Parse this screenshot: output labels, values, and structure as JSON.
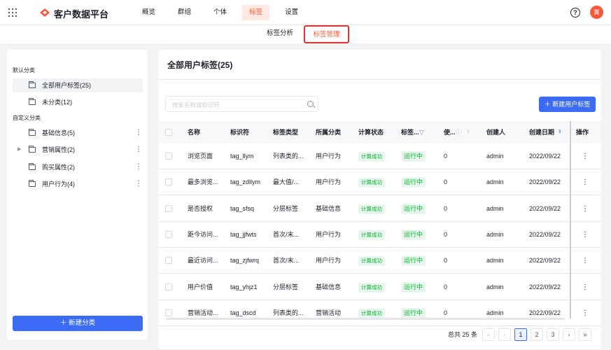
{
  "header": {
    "app_name": "客户数据平台",
    "nav": [
      "概览",
      "群组",
      "个体",
      "标签",
      "设置"
    ],
    "active_nav": "标签",
    "help_icon": "?",
    "avatar_text": "翼"
  },
  "subnav": {
    "tabs": [
      "标签分析",
      "标签管理"
    ],
    "active": "标签管理"
  },
  "sidebar": {
    "default_group": "默认分类",
    "default_items": [
      {
        "label": "全部用户标签(25)",
        "active": true
      },
      {
        "label": "未分类(12)",
        "active": false
      }
    ],
    "custom_group": "自定义分类",
    "custom_items": [
      {
        "label": "基础信息(5)",
        "expandable": false
      },
      {
        "label": "营销属性(2)",
        "expandable": true
      },
      {
        "label": "购买属性(2)",
        "expandable": false
      },
      {
        "label": "用户行为(4)",
        "expandable": false
      }
    ],
    "new_button": "新建分类"
  },
  "main": {
    "title": "全部用户标签(25)",
    "search_placeholder": "搜索名称或标识符",
    "new_button": "新建用户标签",
    "columns": [
      "名称",
      "标识符",
      "标签类型",
      "所属分类",
      "计算状态",
      "标签...",
      "使...",
      "创建人",
      "创建日期",
      "操作"
    ],
    "rows": [
      {
        "name": "浏览页面",
        "id": "tag_llym",
        "type": "列表类的...",
        "category": "用户行为",
        "calc": "计算成功",
        "status": "运行中",
        "uses": "0",
        "creator": "admin",
        "date": "2022/09/22"
      },
      {
        "name": "最多浏览...",
        "id": "tag_zdllym",
        "type": "最大值/...",
        "category": "用户行为",
        "calc": "计算成功",
        "status": "运行中",
        "uses": "0",
        "creator": "admin",
        "date": "2022/09/22"
      },
      {
        "name": "是否授权",
        "id": "tag_sfsq",
        "type": "分层标签",
        "category": "基础信息",
        "calc": "计算成功",
        "status": "运行中",
        "uses": "0",
        "creator": "admin",
        "date": "2022/09/22"
      },
      {
        "name": "距今访问...",
        "id": "tag_jjfwts",
        "type": "首次/末...",
        "category": "用户行为",
        "calc": "计算成功",
        "status": "运行中",
        "uses": "0",
        "creator": "admin",
        "date": "2022/09/22"
      },
      {
        "name": "最近访问...",
        "id": "tag_zjfwrq",
        "type": "首次/末...",
        "category": "用户行为",
        "calc": "计算成功",
        "status": "运行中",
        "uses": "0",
        "creator": "admin",
        "date": "2022/09/22"
      },
      {
        "name": "用户价值",
        "id": "tag_yhjz1",
        "type": "分层标签",
        "category": "基础信息",
        "calc": "计算成功",
        "status": "运行中",
        "uses": "0",
        "creator": "admin",
        "date": "2022/09/22"
      },
      {
        "name": "营销活动...",
        "id": "tag_dscd",
        "type": "列表类的...",
        "category": "营销活动",
        "calc": "计算成功",
        "status": "运行中",
        "uses": "0",
        "creator": "admin",
        "date": "2022/09/22"
      }
    ],
    "action_icon": "⋮",
    "pagination": {
      "total_text": "总共 25 条",
      "pages": [
        "1",
        "2",
        "3"
      ],
      "current": "1"
    }
  },
  "colors": {
    "brand": "#f5593a",
    "primary": "#3c6cf5",
    "success": "#00b42a"
  }
}
